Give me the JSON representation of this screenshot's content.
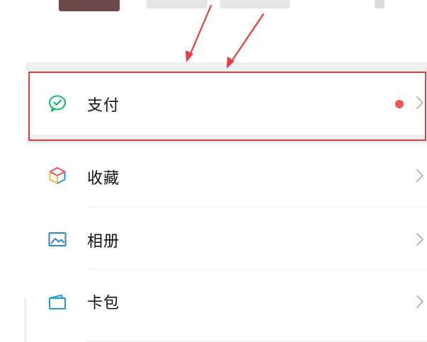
{
  "menu": {
    "items": [
      {
        "id": "pay",
        "label": "支付",
        "icon": "wechat-pay-icon",
        "has_badge": true
      },
      {
        "id": "favorites",
        "label": "收藏",
        "icon": "favorites-cube-icon",
        "has_badge": false
      },
      {
        "id": "album",
        "label": "相册",
        "icon": "photo-album-icon",
        "has_badge": false
      },
      {
        "id": "cards",
        "label": "卡包",
        "icon": "card-wallet-icon",
        "has_badge": false
      }
    ]
  },
  "annotations": {
    "highlight_color": "#e53c3c",
    "arrow_color": "#e53c3c"
  },
  "colors": {
    "pay_icon": "#07c160",
    "badge": "#f25454",
    "album_icon": "#2a88c7",
    "cards_icon": "#1a9bd7",
    "label_text": "#111111",
    "chevron": "#b8b8b8",
    "separator": "#efefef"
  }
}
